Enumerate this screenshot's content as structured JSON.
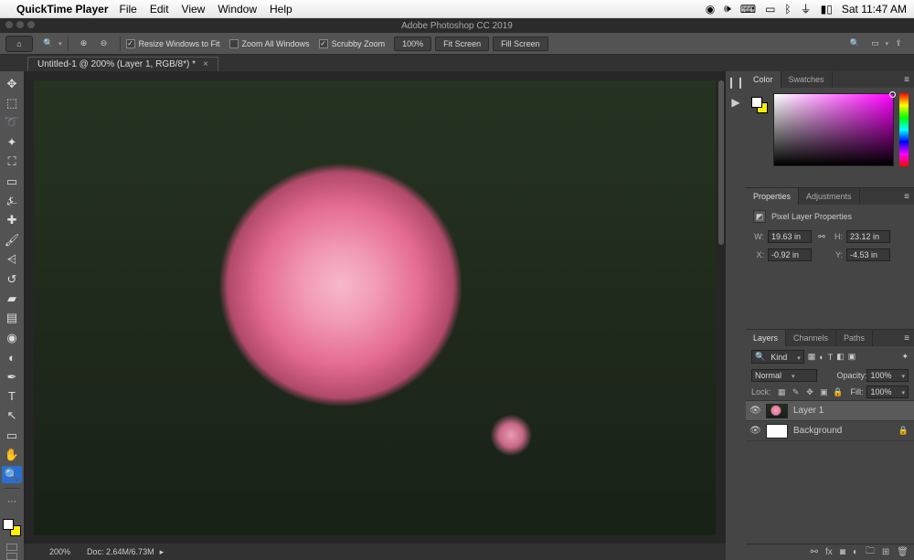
{
  "menubar": {
    "app": "QuickTime Player",
    "items": [
      "File",
      "Edit",
      "View",
      "Window",
      "Help"
    ],
    "clock": "Sat 11:47 AM"
  },
  "titlebar": {
    "title": "Adobe Photoshop CC 2019"
  },
  "optionsbar": {
    "resize_windows": "Resize Windows to Fit",
    "zoom_all": "Zoom All Windows",
    "scrubby": "Scrubby Zoom",
    "zoom_pct": "100%",
    "fit_screen": "Fit Screen",
    "fill_screen": "Fill Screen"
  },
  "doc_tab": {
    "label": "Untitled-1 @ 200% (Layer 1, RGB/8*) *"
  },
  "statusbar": {
    "zoom": "200%",
    "doc": "Doc: 2.64M/6.73M"
  },
  "panels": {
    "color_tab": "Color",
    "swatches_tab": "Swatches",
    "properties_tab": "Properties",
    "adjustments_tab": "Adjustments",
    "pixel_layer_props": "Pixel Layer Properties",
    "props": {
      "w": "19.63 in",
      "h": "23.12 in",
      "x": "-0.92 in",
      "y": "-4.53 in",
      "w_label": "W:",
      "h_label": "H:",
      "x_label": "X:",
      "y_label": "Y:"
    },
    "layers_tab": "Layers",
    "channels_tab": "Channels",
    "paths_tab": "Paths",
    "kind_label": "Kind",
    "blend_mode": "Normal",
    "opacity_label": "Opacity:",
    "opacity_value": "100%",
    "lock_label": "Lock:",
    "fill_label": "Fill:",
    "fill_value": "100%",
    "layer1": "Layer 1",
    "background": "Background"
  },
  "icons": {
    "home": "⌂",
    "zoom": "🔍",
    "zoom_in": "⊕",
    "zoom_out": "⊖",
    "grid": "▦",
    "frame": "▭",
    "share": "⇪",
    "move": "✥",
    "marquee": "⬚",
    "lasso": "➰",
    "wand": "✦",
    "crop": "⛶",
    "eyedrop": "⍼",
    "heal": "✚",
    "brush": "🖌",
    "stamp": "⩤",
    "history": "↺",
    "eraser": "▰",
    "gradient": "▤",
    "blur": "◉",
    "dodge": "◐",
    "pen": "✒",
    "type": "T",
    "path": "↖",
    "rect": "▭",
    "hand": "✋",
    "mag": "🔍",
    "hist": "❙❙",
    "play": "▶",
    "eye": "👁",
    "lock": "🔒",
    "link": "⚯",
    "fx": "fx",
    "mask": "◙",
    "folder": "🗀",
    "new": "⊞",
    "trash": "🗑",
    "search": "🔍",
    "menu": "≡"
  }
}
